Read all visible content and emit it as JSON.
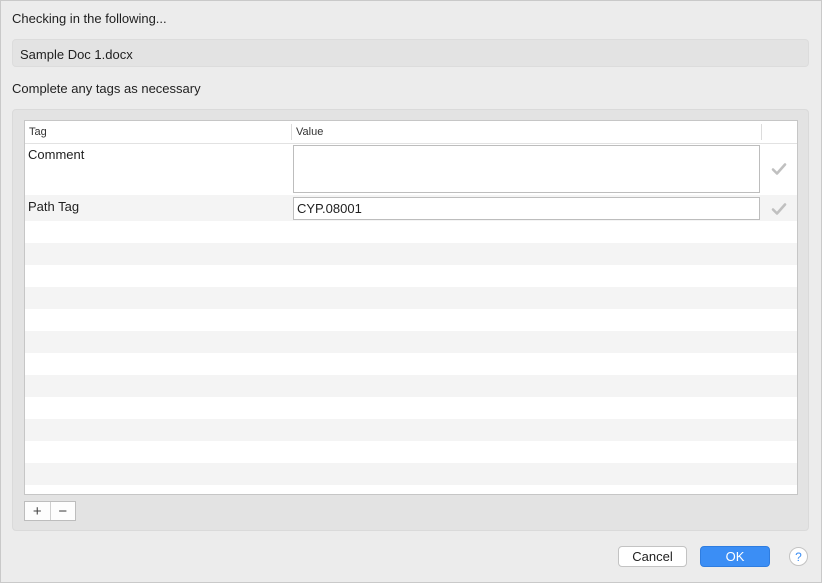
{
  "header": {
    "checking_label": "Checking in the following..."
  },
  "document": {
    "name": "Sample Doc 1.docx"
  },
  "tags_section": {
    "label": "Complete any tags as necessary"
  },
  "table": {
    "columns": [
      "Tag",
      "Value"
    ],
    "rows": [
      {
        "tag": "Comment",
        "value": ""
      },
      {
        "tag": "Path Tag",
        "value": "CYP.08001"
      }
    ]
  },
  "controls": {
    "add_symbol": "+",
    "remove_symbol": "−"
  },
  "footer": {
    "cancel_label": "Cancel",
    "ok_label": "OK",
    "help_symbol": "?"
  },
  "colors": {
    "accent": "#3b8ef5",
    "check": "#c0c0c0"
  },
  "icons": {
    "row_confirm": "checkmark-icon"
  }
}
